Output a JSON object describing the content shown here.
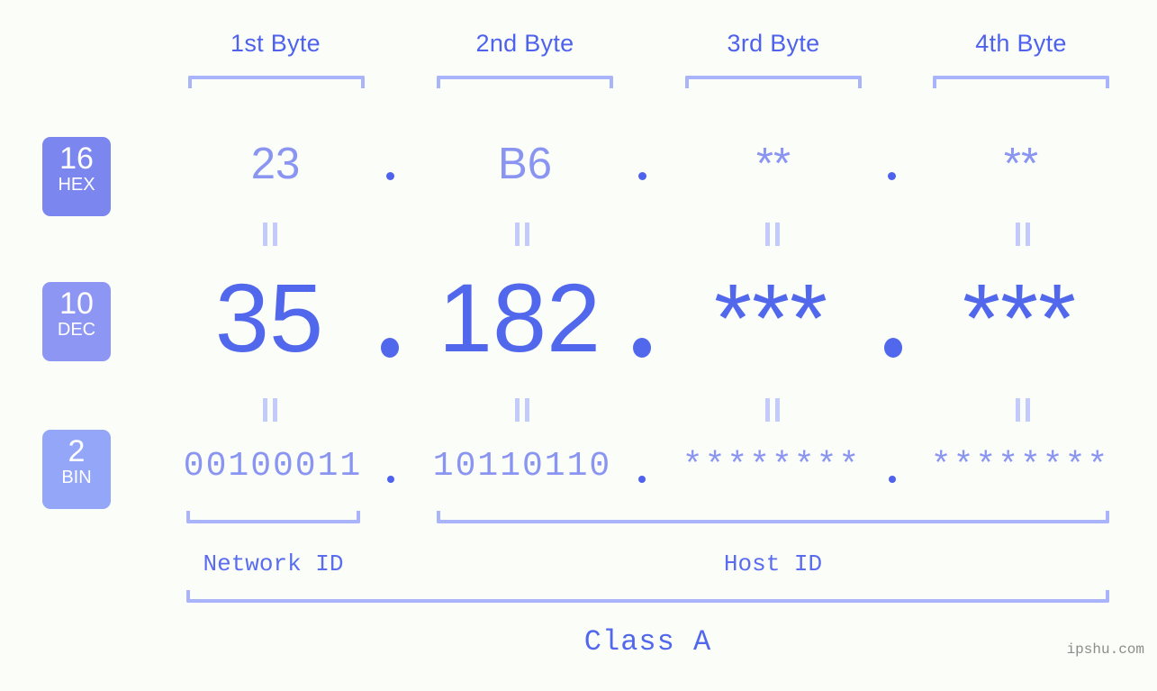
{
  "meta": {
    "background_color": "#fbfdf8",
    "accent_color": "#5268ec",
    "accent_light_color": "#8a95f2",
    "bracket_color": "#aab4fb",
    "watermark": "ipshu.com"
  },
  "byte_headers": [
    {
      "label": "1st Byte"
    },
    {
      "label": "2nd Byte"
    },
    {
      "label": "3rd Byte"
    },
    {
      "label": "4th Byte"
    }
  ],
  "bases": [
    {
      "id": "hex",
      "number": "16",
      "name": "HEX",
      "color": "#7b86ef"
    },
    {
      "id": "dec",
      "number": "10",
      "name": "DEC",
      "color": "#8d96f3"
    },
    {
      "id": "bin",
      "number": "2",
      "name": "BIN",
      "color": "#93a6f7"
    }
  ],
  "rows": {
    "hex": {
      "values": [
        "23",
        "B6",
        "**",
        "**"
      ],
      "separator": "."
    },
    "dec": {
      "values": [
        "35",
        "182",
        "***",
        "***"
      ],
      "separator": "."
    },
    "bin": {
      "values": [
        "00100011",
        "10110110",
        "********",
        "********"
      ],
      "separator": "."
    }
  },
  "equality_symbol": "=",
  "footer": {
    "network_id": "Network ID",
    "host_id": "Host ID",
    "class": "Class A"
  }
}
